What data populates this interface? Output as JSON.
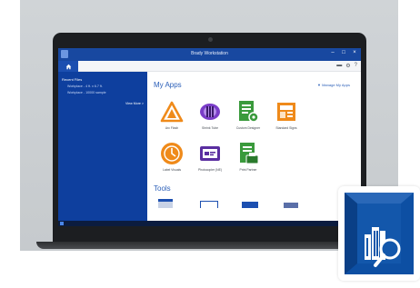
{
  "window": {
    "title": "Brady Workstation",
    "minimize": "–",
    "maximize": "□",
    "close": "×"
  },
  "toolbar": {
    "settings_icon": "gear-icon",
    "help_label": "?"
  },
  "sidebar": {
    "heading": "Recent Files",
    "items": [
      {
        "label": "Workplace - 4 ft. x 6.7 ft."
      },
      {
        "label": "Workplace - 10000 sample"
      }
    ],
    "view_more": "View More >"
  },
  "main": {
    "my_apps_title": "My Apps",
    "manage_link": "Manage My Apps",
    "tools_title": "Tools",
    "apps": [
      {
        "label": "Arc Flash",
        "icon": "warning-triangle-icon"
      },
      {
        "label": "Shrink Tube",
        "icon": "shrink-tube-icon"
      },
      {
        "label": "Custom Designer",
        "icon": "custom-designer-icon"
      },
      {
        "label": "Standard Signs",
        "icon": "standard-signs-icon"
      },
      {
        "label": "Label Visuals",
        "icon": "label-visuals-icon"
      },
      {
        "label": "Photocopier (NE)",
        "icon": "photocopier-icon"
      },
      {
        "label": "Print Partner",
        "icon": "print-partner-icon"
      }
    ]
  },
  "colors": {
    "brand_blue": "#1848a0",
    "sidebar_blue": "#0e3f9e",
    "accent_orange": "#ef8a1a",
    "accent_green": "#3a9a3c",
    "accent_purple": "#5a2ea0"
  }
}
